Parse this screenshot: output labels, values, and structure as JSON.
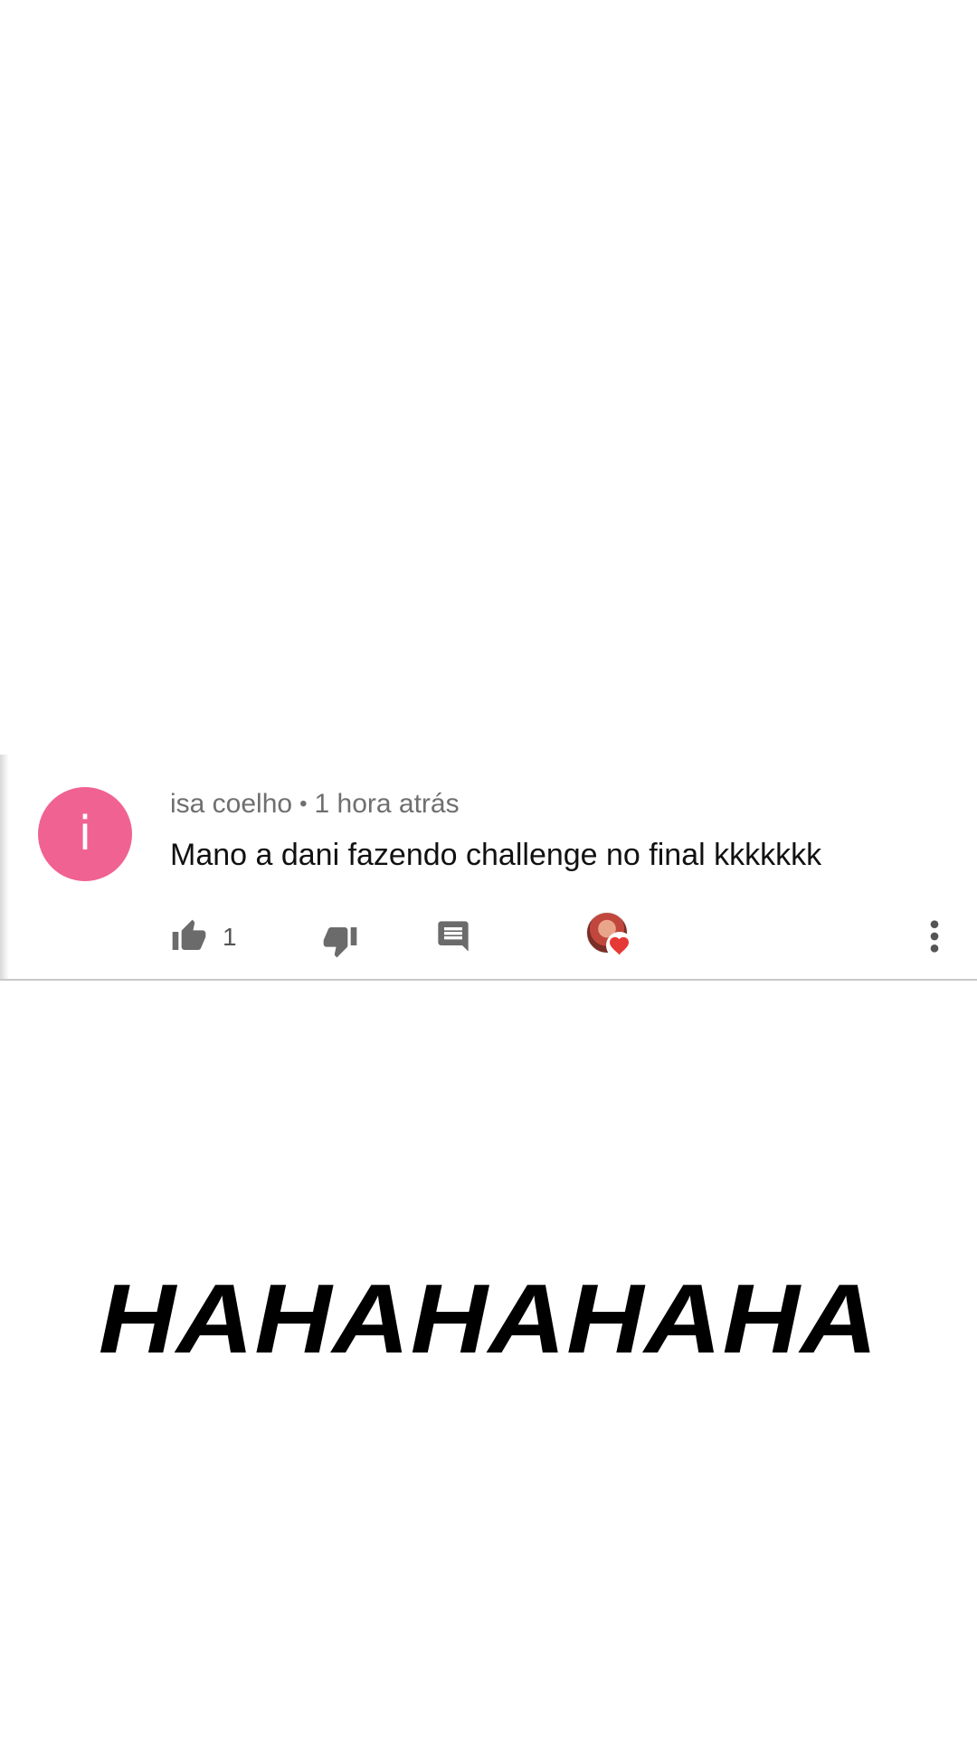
{
  "comment": {
    "author": "isa coelho",
    "separator": "•",
    "time": "1 hora atrás",
    "avatar_letter": "i",
    "avatar_color": "#f06292",
    "text": "Mano a dani fazendo challenge no final kkkkkkk",
    "like_count": "1",
    "icons": {
      "like": "thumbs-up-icon",
      "dislike": "thumbs-down-icon",
      "reply": "reply-comment-icon",
      "creator_heart": "creator-heart-icon",
      "more": "more-vertical-icon"
    }
  },
  "overlay": {
    "text": "HAHAHAHAHA"
  }
}
